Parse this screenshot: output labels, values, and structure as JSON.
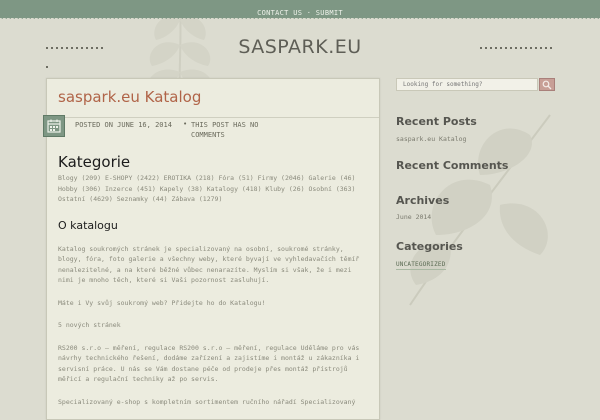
{
  "topbar": {
    "contact": "CONTACT US",
    "separator": " · ",
    "submit": "SUBMIT"
  },
  "site": {
    "title": "SASPARK.EU"
  },
  "post": {
    "title": "saspark.eu Katalog",
    "posted": "POSTED ON JUNE 16, 2014",
    "comments": "THIS POST HAS NO COMMENTS",
    "heading": "Kategorie",
    "categories": "Blogy (209) E-SHOPY (2422) EROTIKA (218) Fóra (51) Firmy (2046) Galerie (46) Hobby (306) Inzerce (451) Kapely (38) Katalogy (418) Kluby (26) Osobní (363) Ostatní (4629) Seznamky (44) Zábava (1279)",
    "subheading": "O katalogu",
    "para1": "Katalog soukromých stránek je specializovaný na osobní, soukromé stránky, blogy, fóra, foto galerie a všechny weby, které byvají ve vyhledavačích těmíř nenalezitelné, a na které běžné vůbec nenarazíte. Myslím si však, že i mezi nimi je mnoho těch, které si Vaši pozornost zasluhují.",
    "para2": "Máte i Vy svůj soukromý web? Přidejte ho do Katalogu!",
    "para3": "5 nových stránek",
    "para4": "RS200 s.r.o – měření, regulace RS200 s.r.o – měření, regulace Uděláme pro vás návrhy technického řešení, dodáme zařízení a zajistíme i montáž u zákazníka i servisní práce. U nás se Vám dostane péče od prodeje přes montáž přístrojů měřicí a regulační techniky až po servis.",
    "para5": "Specializovaný e-shop s kompletním sortimentem ručního nářadí Specializovaný"
  },
  "sidebar": {
    "search_placeholder": "Looking for something?",
    "recent_posts_title": "Recent Posts",
    "recent_posts": [
      "saspark.eu Katalog"
    ],
    "recent_comments_title": "Recent Comments",
    "archives_title": "Archives",
    "archives": [
      "June 2014"
    ],
    "categories_title": "Categories",
    "categories": [
      "UNCATEGORIZED"
    ]
  },
  "colors": {
    "background": "#dcdcd0",
    "topbar": "#7e9784",
    "post_title": "#b06448",
    "search_button": "#c89f96"
  },
  "icons": {
    "calendar": "calendar-icon",
    "search": "search-icon"
  }
}
